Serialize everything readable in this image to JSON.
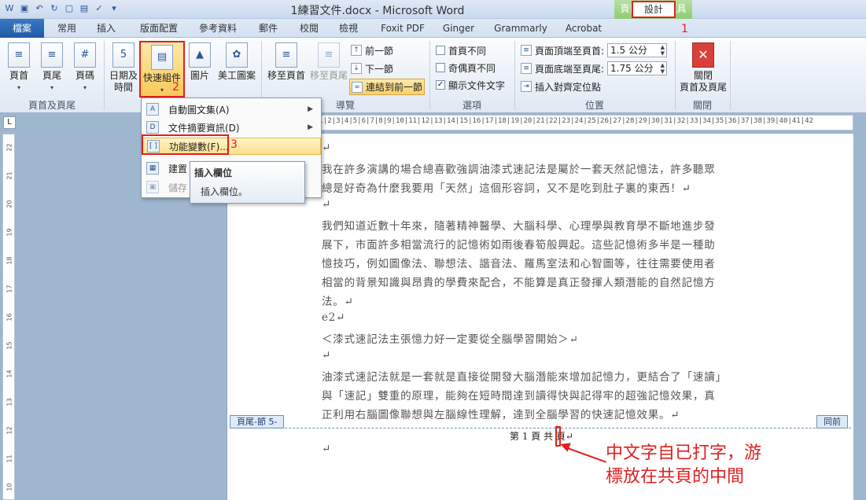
{
  "window": {
    "title": "1練習文件.docx - Microsoft Word",
    "context_group": "頁首及頁尾工具"
  },
  "tabs": [
    "檔案",
    "常用",
    "插入",
    "版面配置",
    "參考資料",
    "郵件",
    "校閱",
    "檢視",
    "Foxit PDF",
    "Ginger",
    "Grammarly",
    "Acrobat",
    "設計"
  ],
  "annotations": {
    "tab_num": "1",
    "quickparts_num": "2",
    "field_num": "3"
  },
  "ribbon": {
    "group1": {
      "label": "頁首及頁尾",
      "header": "頁首",
      "footer": "頁尾",
      "page_number": "頁碼"
    },
    "insert": {
      "datetime_1": "日期及",
      "datetime_2": "時間",
      "quickparts": "快速組件",
      "picture": "圖片",
      "clipart": "美工圖案"
    },
    "nav": {
      "label": "導覽",
      "goto_header": "移至頁首",
      "goto_footer": "移至頁尾",
      "prev": "前一節",
      "next": "下一節",
      "link_prev": "連結到前一節"
    },
    "options": {
      "label": "選項",
      "diff_first": "首頁不同",
      "diff_odd_even": "奇偶頁不同",
      "show_text": "顯示文件文字"
    },
    "position": {
      "label": "位置",
      "header_top": "頁面頂端至頁首:",
      "header_top_val": "1.5 公分",
      "footer_bottom": "頁面底端至頁尾:",
      "footer_bottom_val": "1.75 公分",
      "align_tab": "插入對齊定位點"
    },
    "close": {
      "label": "關閉",
      "btn_1": "關閉",
      "btn_2": "頁首及頁尾"
    }
  },
  "menu": {
    "items": [
      "自動圖文集(A)",
      "文件摘要資訊(D)",
      "功能變數(F)...",
      "建置",
      "儲存"
    ]
  },
  "tooltip": {
    "title": "插入欄位",
    "body": "插入欄位。"
  },
  "ruler_text": "|1|2|3|4|5|6|7|8|9|10|11|12|13|14|15|16|17|18|19|20|21|22|23|24|25|26|27|28|29|30|31|32|33|34|35|36|37|38|39|40|41|42",
  "document": {
    "lines": [
      "↵",
      "我在許多演講的場合總喜歡強調油漆式速記法是屬於一套天然記憶法，許多聽眾",
      "總是好奇為什麼我要用「天然」這個形容詞，又不是吃到肚子裏的東西！↵",
      "↵",
      "我們知道近數十年來，隨著精神醫學、大腦科學、心理學與教育學不斷地進步發",
      "展下，市面許多相當流行的記憶術如雨後春筍般興起。這些記憶術多半是一種助",
      "憶技巧，例如圖像法、聯想法、諧音法、羅馬室法和心智圖等，往往需要使用者",
      "相當的背景知識與昂貴的學費來配合，不能算是真正發揮人類潛能的自然記憶方",
      "法。↵",
      "e2↵",
      "＜漆式速記法主張憶力好一定要從全腦學習開始＞↵",
      "↵",
      "油漆式速記法就是一套就是直接從開發大腦潛能來增加記憶力，更結合了「速讀」",
      "與「速記」雙重的原理，能夠在短時間達到讀得快與記得牢的超強記憶效果，真",
      "正利用右腦圖像聯想與左腦線性理解，達到全腦學習的快速記憶效果。↵"
    ],
    "footer_label": "頁尾-節 5-",
    "same_as_prev": "同前",
    "footer_text": "第 1 頁  共 頁↵",
    "footer_blank": "↵"
  },
  "callout": {
    "line1": "中文字自已打字，游",
    "line2": "標放在共頁的中間"
  }
}
